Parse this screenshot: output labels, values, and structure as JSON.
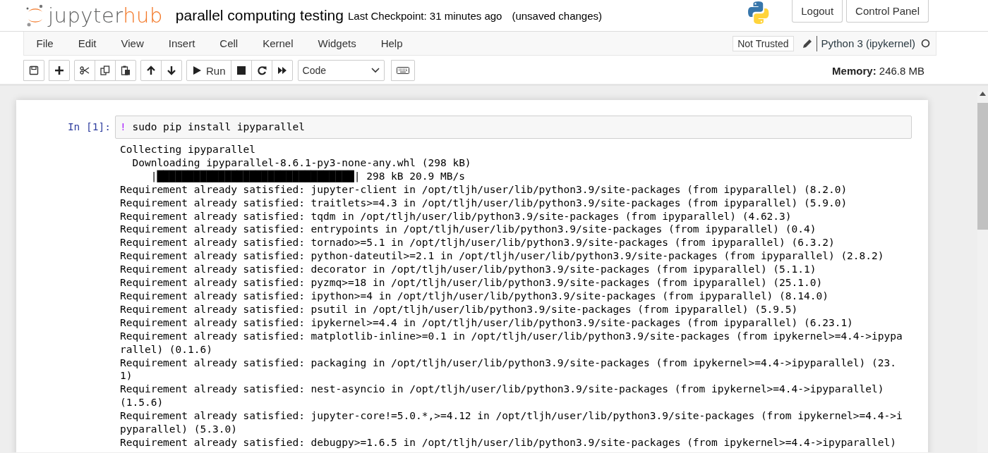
{
  "header": {
    "logo": {
      "text": "jupyter",
      "accent": "hub"
    },
    "notebook_name": "parallel computing testing",
    "checkpoint": "Last Checkpoint: 31 minutes ago",
    "autosave_status": "(unsaved changes)",
    "buttons": [
      "Logout",
      "Control Panel"
    ]
  },
  "menubar": {
    "menus": [
      "File",
      "Edit",
      "View",
      "Insert",
      "Cell",
      "Kernel",
      "Widgets",
      "Help"
    ],
    "trust_status": "Not Trusted",
    "kernel_name": "Python 3 (ipykernel)"
  },
  "toolbar": {
    "run_label": "Run",
    "cell_type": "Code",
    "memory_label": "Memory:",
    "memory_value": "246.8 MB"
  },
  "cell": {
    "prompt": "In [1]:",
    "code_bang": "!",
    "code": "sudo pip install ipyparallel",
    "output_lines": [
      "Collecting ipyparallel",
      "  Downloading ipyparallel-8.6.1-py3-none-any.whl (298 kB)",
      "     |████████████████████████████████| 298 kB 20.9 MB/s",
      "Requirement already satisfied: jupyter-client in /opt/tljh/user/lib/python3.9/site-packages (from ipyparallel) (8.2.0)",
      "Requirement already satisfied: traitlets>=4.3 in /opt/tljh/user/lib/python3.9/site-packages (from ipyparallel) (5.9.0)",
      "Requirement already satisfied: tqdm in /opt/tljh/user/lib/python3.9/site-packages (from ipyparallel) (4.62.3)",
      "Requirement already satisfied: entrypoints in /opt/tljh/user/lib/python3.9/site-packages (from ipyparallel) (0.4)",
      "Requirement already satisfied: tornado>=5.1 in /opt/tljh/user/lib/python3.9/site-packages (from ipyparallel) (6.3.2)",
      "Requirement already satisfied: python-dateutil>=2.1 in /opt/tljh/user/lib/python3.9/site-packages (from ipyparallel) (2.8.2)",
      "Requirement already satisfied: decorator in /opt/tljh/user/lib/python3.9/site-packages (from ipyparallel) (5.1.1)",
      "Requirement already satisfied: pyzmq>=18 in /opt/tljh/user/lib/python3.9/site-packages (from ipyparallel) (25.1.0)",
      "Requirement already satisfied: ipython>=4 in /opt/tljh/user/lib/python3.9/site-packages (from ipyparallel) (8.14.0)",
      "Requirement already satisfied: psutil in /opt/tljh/user/lib/python3.9/site-packages (from ipyparallel) (5.9.5)",
      "Requirement already satisfied: ipykernel>=4.4 in /opt/tljh/user/lib/python3.9/site-packages (from ipyparallel) (6.23.1)",
      "Requirement already satisfied: matplotlib-inline>=0.1 in /opt/tljh/user/lib/python3.9/site-packages (from ipykernel>=4.4->ipypa",
      "rallel) (0.1.6)",
      "Requirement already satisfied: packaging in /opt/tljh/user/lib/python3.9/site-packages (from ipykernel>=4.4->ipyparallel) (23.",
      "1)",
      "Requirement already satisfied: nest-asyncio in /opt/tljh/user/lib/python3.9/site-packages (from ipykernel>=4.4->ipyparallel)",
      "(1.5.6)",
      "Requirement already satisfied: jupyter-core!=5.0.*,>=4.12 in /opt/tljh/user/lib/python3.9/site-packages (from ipykernel>=4.4->i",
      "pyparallel) (5.3.0)",
      "Requirement already satisfied: debugpy>=1.6.5 in /opt/tljh/user/lib/python3.9/site-packages (from ipykernel>=4.4->ipyparallel)"
    ]
  }
}
